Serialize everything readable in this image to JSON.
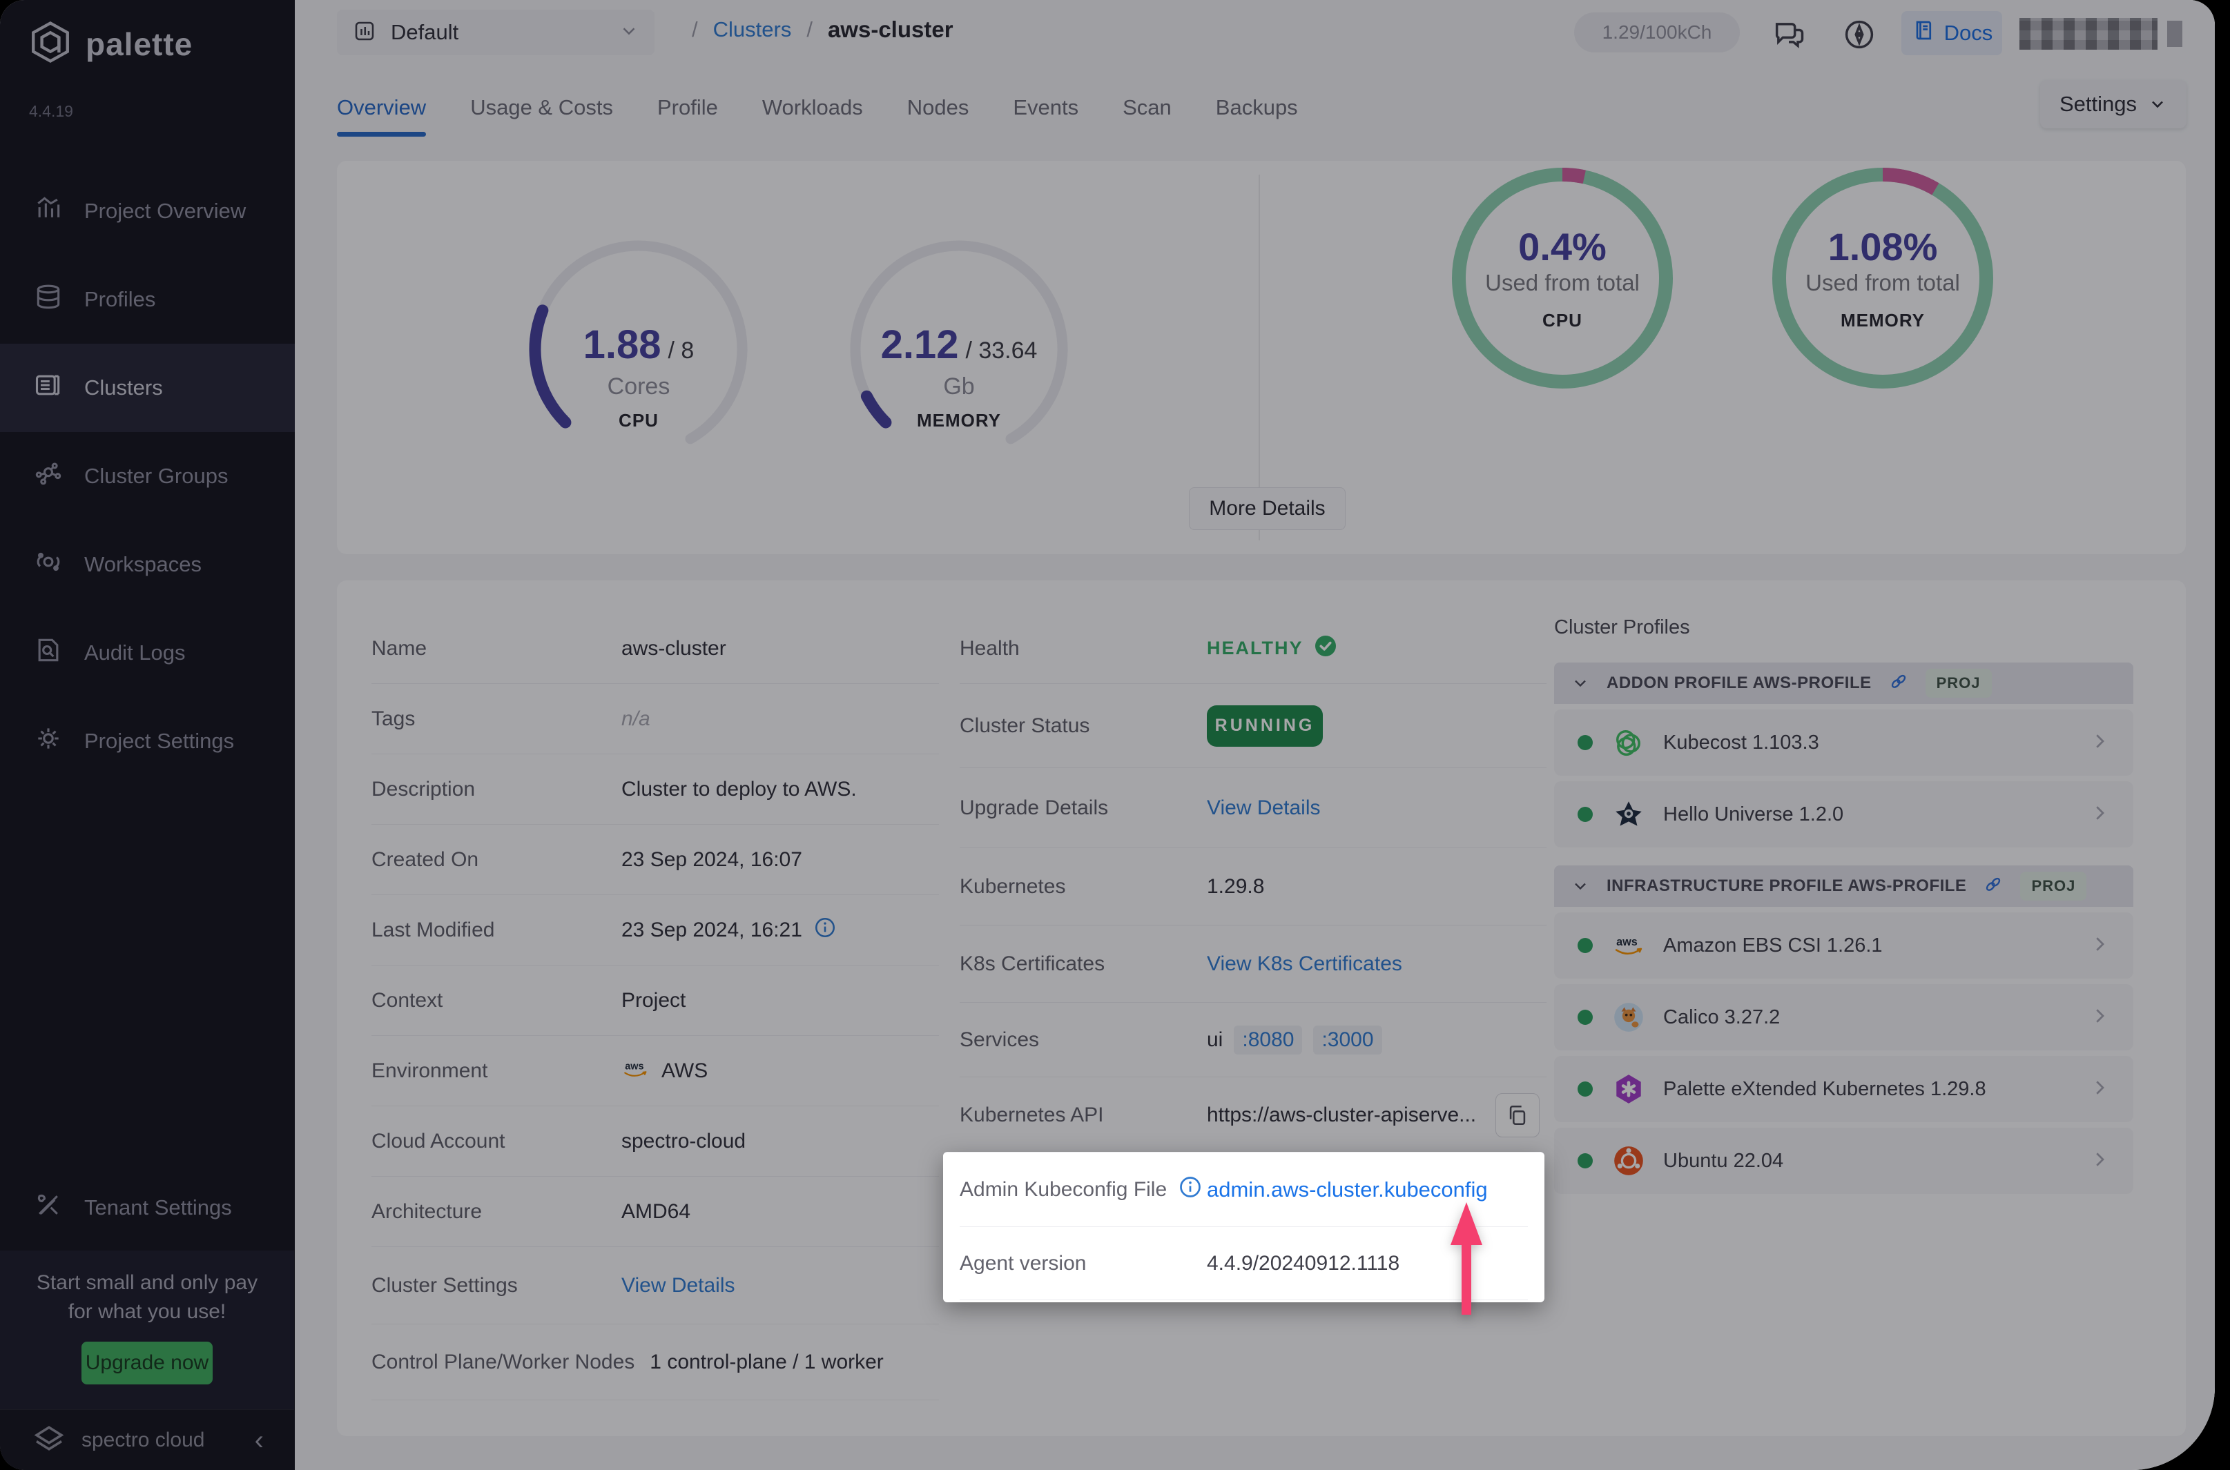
{
  "app": {
    "brand": "palette",
    "version": "4.4.19"
  },
  "topbar": {
    "project_selector": {
      "label": "Default"
    },
    "breadcrumb": {
      "sep": "/",
      "root": "Clusters",
      "current": "aws-cluster"
    },
    "usage_pill": "1.29/100kCh",
    "docs_label": "Docs"
  },
  "tabs": {
    "items": [
      "Overview",
      "Usage & Costs",
      "Profile",
      "Workloads",
      "Nodes",
      "Events",
      "Scan",
      "Backups"
    ],
    "active": "Overview",
    "settings_label": "Settings"
  },
  "sidebar": {
    "items": [
      {
        "label": "Project Overview",
        "icon": "bar-chart-icon",
        "active": false
      },
      {
        "label": "Profiles",
        "icon": "layers-icon",
        "active": false
      },
      {
        "label": "Clusters",
        "icon": "server-icon",
        "active": true
      },
      {
        "label": "Cluster Groups",
        "icon": "nodes-icon",
        "active": false
      },
      {
        "label": "Workspaces",
        "icon": "orbit-icon",
        "active": false
      },
      {
        "label": "Audit Logs",
        "icon": "audit-icon",
        "active": false
      },
      {
        "label": "Project Settings",
        "icon": "gear-icon",
        "active": false
      }
    ],
    "tenant_settings": {
      "label": "Tenant Settings",
      "icon": "tools-icon"
    },
    "promo": {
      "line1": "Start small and only pay",
      "line2": "for what you use!",
      "cta": "Upgrade now"
    },
    "footer": {
      "brand": "spectro cloud"
    }
  },
  "chart_data": [
    {
      "type": "gauge",
      "name": "cpu-usage-gauge",
      "value": 1.88,
      "total": 8,
      "value_label": "1.88",
      "total_label": "/ 8",
      "unit": "Cores",
      "caption": "CPU",
      "start_angle": 225,
      "arc_degrees": 285,
      "track_color": "#e9e9ef",
      "fill_color": "#45419e"
    },
    {
      "type": "gauge",
      "name": "memory-usage-gauge",
      "value": 2.12,
      "total": 33.64,
      "value_label": "2.12",
      "total_label": "/ 33.64",
      "unit": "Gb",
      "caption": "MEMORY",
      "start_angle": 225,
      "arc_degrees": 285,
      "track_color": "#e9e9ef",
      "fill_color": "#45419e"
    },
    {
      "type": "donut",
      "name": "cpu-used-donut",
      "pct_label": "0.4%",
      "subtitle": "Used from total",
      "caption": "CPU",
      "used_fraction": 0.034,
      "ring_color": "#8ed1b1",
      "used_color": "#cf5f9e"
    },
    {
      "type": "donut",
      "name": "memory-used-donut",
      "pct_label": "1.08%",
      "subtitle": "Used from total",
      "caption": "MEMORY",
      "used_fraction": 0.085,
      "ring_color": "#8ed1b1",
      "used_color": "#cf5f9e"
    }
  ],
  "overview_card": {
    "more_details": "More Details"
  },
  "details": {
    "left": [
      {
        "label": "Name",
        "value": "aws-cluster"
      },
      {
        "label": "Tags",
        "value": "n/a"
      },
      {
        "label": "Description",
        "value": "Cluster to deploy to AWS."
      },
      {
        "label": "Created On",
        "value": "23 Sep 2024, 16:07"
      },
      {
        "label": "Last Modified",
        "value": "23 Sep 2024, 16:21"
      },
      {
        "label": "Context",
        "value": "Project"
      },
      {
        "label": "Environment",
        "value": "AWS"
      },
      {
        "label": "Cloud Account",
        "value": "spectro-cloud"
      },
      {
        "label": "Architecture",
        "value": "AMD64"
      },
      {
        "label": "Cluster Settings",
        "value": "View Details"
      },
      {
        "label": "Control Plane/Worker Nodes",
        "value": "1 control-plane / 1 worker"
      }
    ],
    "middle": {
      "health": {
        "label": "Health",
        "value": "HEALTHY"
      },
      "cluster_status": {
        "label": "Cluster Status",
        "value": "RUNNING"
      },
      "upgrade_details": {
        "label": "Upgrade Details",
        "value": "View Details"
      },
      "kubernetes": {
        "label": "Kubernetes",
        "value": "1.29.8"
      },
      "k8s_certificates": {
        "label": "K8s Certificates",
        "value": "View K8s Certificates"
      },
      "services": {
        "label": "Services",
        "prefix": "ui",
        "ports": [
          ":8080",
          ":3000"
        ]
      },
      "kubernetes_api": {
        "label": "Kubernetes API",
        "value": "https://aws-cluster-apiserve..."
      },
      "admin_kubeconfig": {
        "label": "Admin Kubeconfig File",
        "value": "admin.aws-cluster.kubeconfig"
      },
      "agent_version": {
        "label": "Agent version",
        "value": "4.4.9/20240912.1118"
      }
    },
    "cluster_profiles": {
      "title": "Cluster Profiles",
      "sections": [
        {
          "header": "ADDON PROFILE AWS-PROFILE",
          "badge": "PROJ",
          "items": [
            {
              "name": "Kubecost 1.103.3",
              "logo": "kubecost-logo"
            },
            {
              "name": "Hello Universe 1.2.0",
              "logo": "hello-universe-logo"
            }
          ]
        },
        {
          "header": "INFRASTRUCTURE PROFILE AWS-PROFILE",
          "badge": "PROJ",
          "items": [
            {
              "name": "Amazon EBS CSI 1.26.1",
              "logo": "aws-logo"
            },
            {
              "name": "Calico 3.27.2",
              "logo": "calico-logo"
            },
            {
              "name": "Palette eXtended Kubernetes 1.29.8",
              "logo": "pxk-logo"
            },
            {
              "name": "Ubuntu 22.04",
              "logo": "ubuntu-logo"
            }
          ]
        }
      ]
    }
  },
  "colors": {
    "accent_blue": "#2668c5",
    "link_blue": "#1a73e8",
    "status_pill_green": "#1f8a4c",
    "healthy_green": "#34ad68",
    "arrow_pink": "#f43f6e",
    "gauge_indigo": "#45419e",
    "donut_green": "#8ed1b1",
    "donut_pink": "#cf5f9e",
    "upgrade_green": "#3fae5f",
    "fab_purple": "#4c41a4"
  }
}
